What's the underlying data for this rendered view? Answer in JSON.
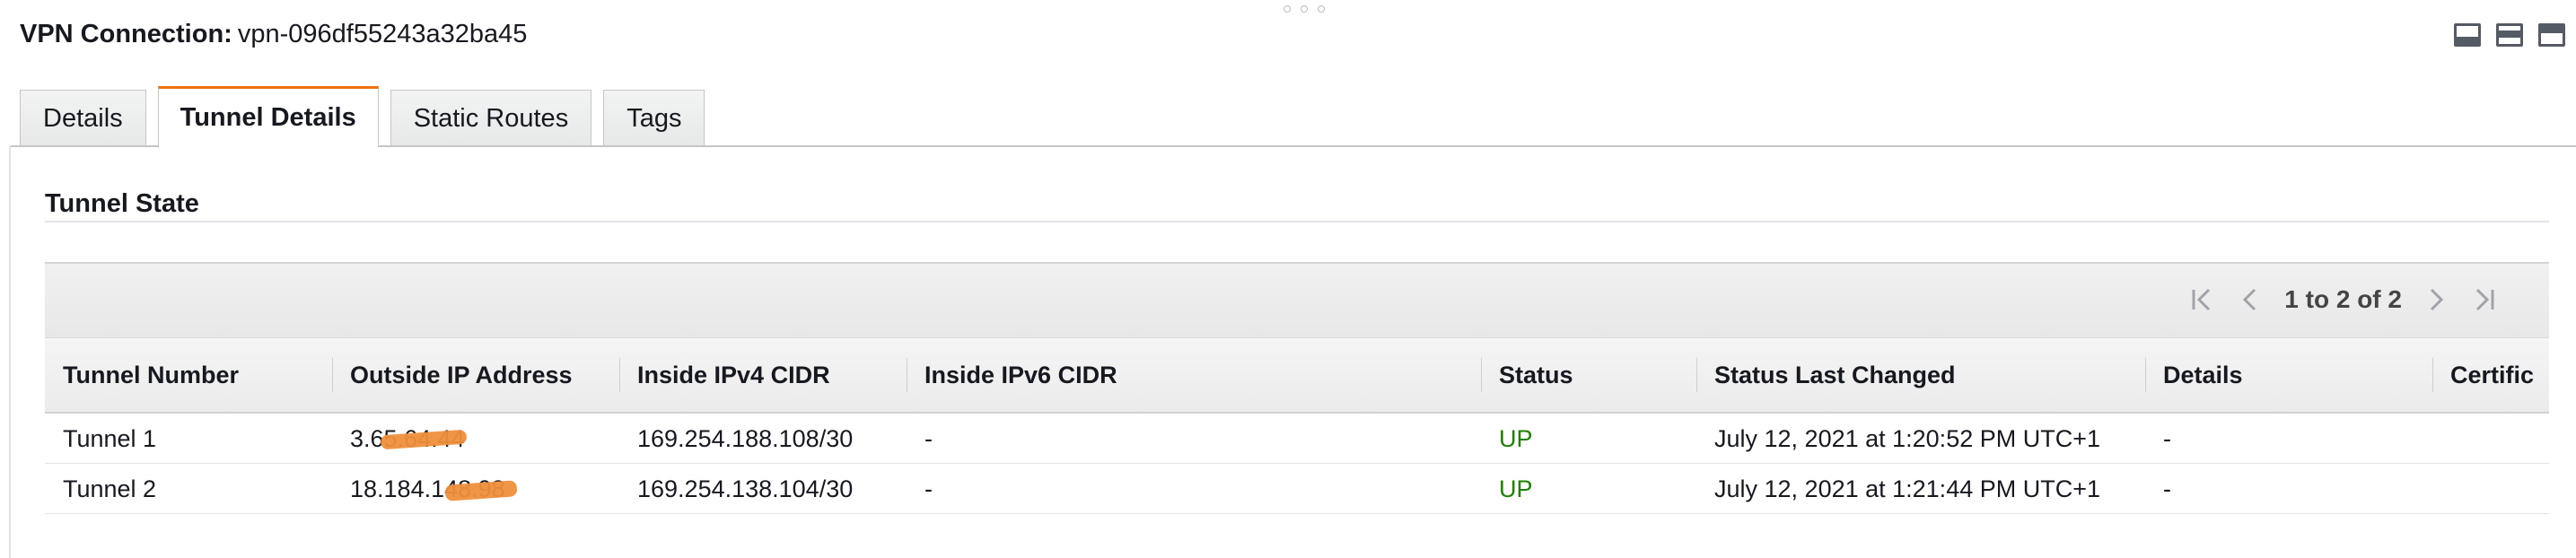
{
  "header": {
    "title_label": "VPN Connection:",
    "title_value": "vpn-096df55243a32ba45"
  },
  "window_controls": [
    {
      "name": "dock-bottom-icon"
    },
    {
      "name": "dock-middle-icon"
    },
    {
      "name": "dock-top-icon"
    }
  ],
  "tabs": [
    {
      "label": "Details",
      "active": false
    },
    {
      "label": "Tunnel Details",
      "active": true
    },
    {
      "label": "Static Routes",
      "active": false
    },
    {
      "label": "Tags",
      "active": false
    }
  ],
  "section": {
    "title": "Tunnel State"
  },
  "pagination": {
    "range_text": "1 to 2 of 2",
    "icons": [
      "first-page-icon",
      "prev-page-icon",
      "next-page-icon",
      "last-page-icon"
    ]
  },
  "table": {
    "columns": [
      "Tunnel Number",
      "Outside IP Address",
      "Inside IPv4 CIDR",
      "Inside IPv6 CIDR",
      "Status",
      "Status Last Changed",
      "Details",
      "Certific"
    ],
    "rows": [
      {
        "tunnel_number": "Tunnel 1",
        "outside_ip": "3.65.64.44",
        "inside_ipv4": "169.254.188.108/30",
        "inside_ipv6": "-",
        "status": "UP",
        "status_last_changed": "July 12, 2021 at 1:20:52 PM UTC+1",
        "details": "-",
        "certificate": ""
      },
      {
        "tunnel_number": "Tunnel 2",
        "outside_ip": "18.184.148.98",
        "inside_ipv4": "169.254.138.104/30",
        "inside_ipv6": "-",
        "status": "UP",
        "status_last_changed": "July 12, 2021 at 1:21:44 PM UTC+1",
        "details": "-",
        "certificate": ""
      }
    ]
  },
  "colors": {
    "active_tab_accent": "#ec7211",
    "status_up": "#1d8102",
    "redaction": "#ee8f3b"
  }
}
